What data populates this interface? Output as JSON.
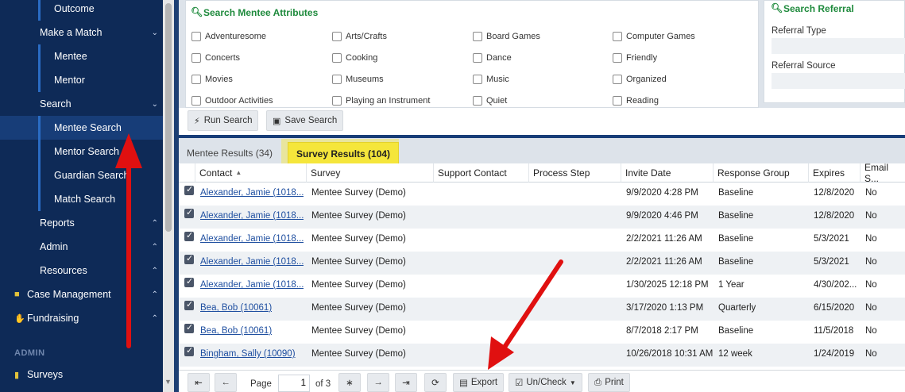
{
  "sidebar": {
    "items": [
      {
        "label": "Outcome"
      },
      {
        "label": "Make a Match"
      },
      {
        "label": "Mentee"
      },
      {
        "label": "Mentor"
      },
      {
        "label": "Search"
      },
      {
        "label": "Mentee Search"
      },
      {
        "label": "Mentor Search"
      },
      {
        "label": "Guardian Search"
      },
      {
        "label": "Match Search"
      },
      {
        "label": "Reports"
      },
      {
        "label": "Admin"
      },
      {
        "label": "Resources"
      },
      {
        "label": "Case Management"
      },
      {
        "label": "Fundraising"
      },
      {
        "label": "Surveys"
      }
    ],
    "admin_heading": "ADMIN"
  },
  "attributes": {
    "title": "Search Mentee Attributes",
    "options": [
      "Adventuresome",
      "Arts/Crafts",
      "Board Games",
      "Computer Games",
      "Concerts",
      "Cooking",
      "Dance",
      "Friendly",
      "Movies",
      "Museums",
      "Music",
      "Organized",
      "Outdoor Activities",
      "Playing an Instrument",
      "Quiet",
      "Reading"
    ]
  },
  "referral": {
    "title": "Search Referral",
    "type_label": "Referral Type",
    "source_label": "Referral Source"
  },
  "buttons": {
    "run_search": "Run Search",
    "save_search": "Save Search"
  },
  "tabs": [
    {
      "label": "Mentee Results (34)"
    },
    {
      "label": "Survey Results (104)"
    }
  ],
  "table": {
    "columns": [
      "Contact",
      "Survey",
      "Support Contact",
      "Process Step",
      "Invite Date",
      "Response Group",
      "Expires",
      "Email S..."
    ],
    "rows": [
      {
        "contact": "Alexander, Jamie (1018...",
        "survey": "Mentee Survey (Demo)",
        "support": "",
        "step": "",
        "invite": "9/9/2020 4:28 PM",
        "group": "Baseline",
        "expires": "12/8/2020",
        "email": "No"
      },
      {
        "contact": "Alexander, Jamie (1018...",
        "survey": "Mentee Survey (Demo)",
        "support": "",
        "step": "",
        "invite": "9/9/2020 4:46 PM",
        "group": "Baseline",
        "expires": "12/8/2020",
        "email": "No"
      },
      {
        "contact": "Alexander, Jamie (1018...",
        "survey": "Mentee Survey (Demo)",
        "support": "",
        "step": "",
        "invite": "2/2/2021 11:26 AM",
        "group": "Baseline",
        "expires": "5/3/2021",
        "email": "No"
      },
      {
        "contact": "Alexander, Jamie (1018...",
        "survey": "Mentee Survey (Demo)",
        "support": "",
        "step": "",
        "invite": "2/2/2021 11:26 AM",
        "group": "Baseline",
        "expires": "5/3/2021",
        "email": "No"
      },
      {
        "contact": "Alexander, Jamie (1018...",
        "survey": "Mentee Survey (Demo)",
        "support": "",
        "step": "",
        "invite": "1/30/2025 12:18 PM",
        "group": "1 Year",
        "expires": "4/30/202...",
        "email": "No"
      },
      {
        "contact": "Bea, Bob (10061)",
        "survey": "Mentee Survey (Demo)",
        "support": "",
        "step": "",
        "invite": "3/17/2020 1:13 PM",
        "group": "Quarterly",
        "expires": "6/15/2020",
        "email": "No"
      },
      {
        "contact": "Bea, Bob (10061)",
        "survey": "Mentee Survey (Demo)",
        "support": "",
        "step": "",
        "invite": "8/7/2018 2:17 PM",
        "group": "Baseline",
        "expires": "11/5/2018",
        "email": "No"
      },
      {
        "contact": "Bingham, Sally (10090)",
        "survey": "Mentee Survey (Demo)",
        "support": "",
        "step": "",
        "invite": "10/26/2018 10:31 AM",
        "group": "12 week",
        "expires": "1/24/2019",
        "email": "No"
      }
    ]
  },
  "pager": {
    "page_label": "Page",
    "page_value": "1",
    "of_label": "of 3",
    "export": "Export",
    "uncheck": "Un/Check",
    "print": "Print"
  },
  "colors": {
    "sidebar_bg": "#0e2a57",
    "accent_green": "#1e8a3c",
    "tab_highlight": "#f5e63b",
    "arrow_red": "#e01010"
  }
}
